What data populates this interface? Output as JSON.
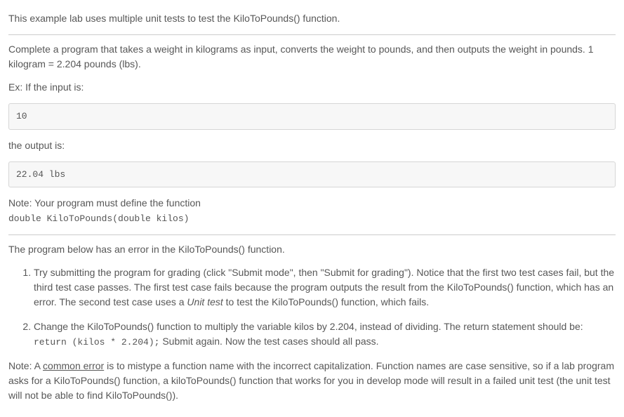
{
  "intro": "This example lab uses multiple unit tests to test the KiloToPounds() function.",
  "task": "Complete a program that takes a weight in kilograms as input, converts the weight to pounds, and then outputs the weight in pounds. 1 kilogram = 2.204 pounds (lbs).",
  "example_label": "Ex: If the input is:",
  "input_value": "10",
  "output_label": "the output is:",
  "output_value": "22.04 lbs",
  "note1_line1": "Note: Your program must define the function",
  "note1_code": "double KiloToPounds(double kilos)",
  "error_intro": "The program below has an error in the KiloToPounds() function.",
  "steps": [
    {
      "text_a": "Try submitting the program for grading (click \"Submit mode\", then \"Submit for grading\"). Notice that the first two test cases fail, but the third test case passes. The first test case fails because the program outputs the result from the KiloToPounds() function, which has an error. The second test case uses a ",
      "italic": "Unit test",
      "text_b": " to test the KiloToPounds() function, which fails."
    },
    {
      "text_a": "Change the KiloToPounds() function to multiply the variable kilos by 2.204, instead of dividing. The return statement should be: ",
      "code": "return (kilos * 2.204);",
      "text_b": " Submit again. Now the test cases should all pass."
    }
  ],
  "note2_a": "Note: A ",
  "note2_u": "common error",
  "note2_b": " is to mistype a function name with the incorrect capitalization. Function names are case sensitive, so if a lab program asks for a KiloToPounds() function, a kiloToPounds() function that works for you in develop mode will result in a failed unit test (the unit test will not be able to find KiloToPounds())."
}
